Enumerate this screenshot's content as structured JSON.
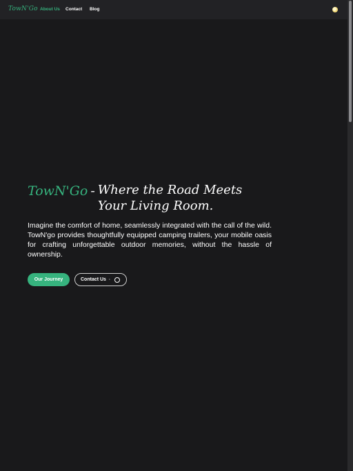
{
  "nav": {
    "brand": "TowN'Go",
    "links": [
      {
        "label": "About Us",
        "active": true
      },
      {
        "label": "Contact",
        "active": false
      },
      {
        "label": "Blog",
        "active": false
      }
    ],
    "theme_toggle_icon": "sun-icon"
  },
  "hero": {
    "brand": "TowN'Go",
    "dash": "-",
    "tagline": "Where the Road Meets Your Living Room.",
    "description": "Imagine the comfort of home, seamlessly integrated with the call of the wild. TowN'go provides thoughtfully equipped camping trailers, your mobile oasis for crafting unforgettable outdoor memories, without the hassle of ownership.",
    "primary_button": "Our Journey",
    "secondary_button": "Contact Us",
    "secondary_separator": "·",
    "secondary_icon": "circle-icon"
  },
  "colors": {
    "background": "#19191b",
    "navbar": "#222225",
    "accent": "#36b37e",
    "text": "#ffffff"
  }
}
